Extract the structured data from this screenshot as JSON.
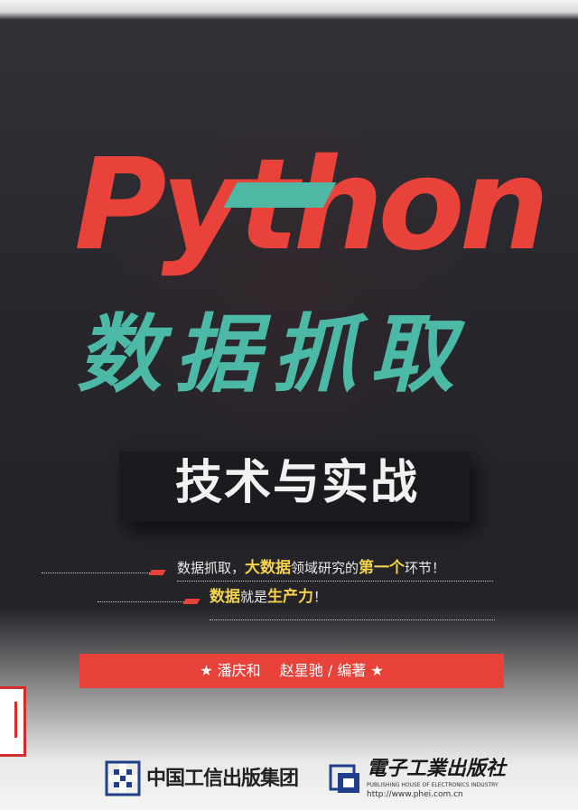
{
  "book": {
    "title_en": "Python",
    "title_cn": "数据抓取",
    "subtitle": "技术与实战"
  },
  "slogans": {
    "line1_a": "数据抓取，",
    "line1_b": "大数据",
    "line1_c": "领域研究的",
    "line1_d": "第一个",
    "line1_e": "环节！",
    "line2_a": "数据",
    "line2_b": "就是",
    "line2_c": "生产力",
    "line2_d": "！"
  },
  "author": {
    "text": "★ 潘庆和　 赵星驰 / 编著 ★"
  },
  "publishers": {
    "pub1_name": "中国工信出版集团",
    "pub2_name": "電子工業出版社",
    "pub2_en": "PUBLISHING HOUSE OF ELECTRONICS INDUSTRY",
    "pub2_url": "http://www.phei.com.cn"
  },
  "colors": {
    "background": "#26262c",
    "title_red": "#e8423a",
    "title_teal": "#4cb9a6",
    "highlight_yellow": "#f3d34a"
  }
}
